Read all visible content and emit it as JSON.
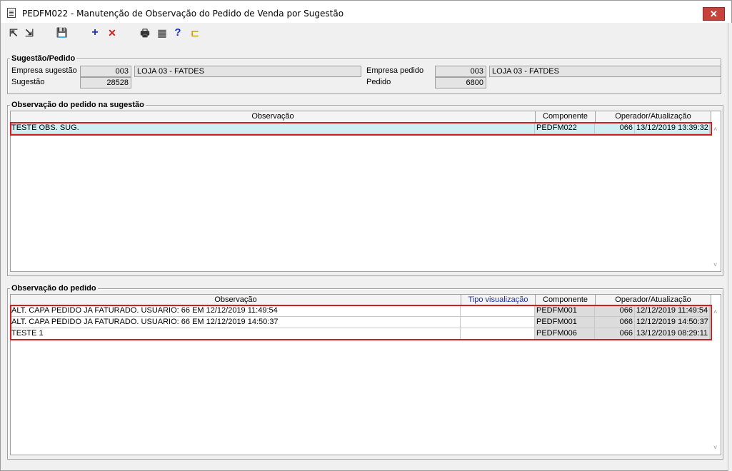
{
  "window": {
    "title": "PEDFM022 - Manutenção de Observação do Pedido de Venda por Sugestão",
    "close_glyph": "✕"
  },
  "toolbar": {
    "btn_first": "⇱",
    "btn_move": "⇲",
    "btn_save": "💾",
    "btn_add": "+",
    "btn_delete": "✕",
    "btn_print": "🖶",
    "btn_grid": "▦",
    "btn_help": "?",
    "btn_exit": "⊏"
  },
  "sugestao_pedido": {
    "label": "Sugestão/Pedido",
    "empresa_sugestao_label": "Empresa sugestão",
    "empresa_sugestao_code": "003",
    "empresa_sugestao_name": "LOJA 03 - FATDES",
    "sugestao_label": "Sugestão",
    "sugestao_value": "28528",
    "empresa_pedido_label": "Empresa pedido",
    "empresa_pedido_code": "003",
    "empresa_pedido_name": "LOJA 03 - FATDES",
    "pedido_label": "Pedido",
    "pedido_value": "6800"
  },
  "obs_sugestao": {
    "label": "Observação do pedido na sugestão",
    "headers": {
      "observacao": "Observação",
      "componente": "Componente",
      "operador": "Operador/Atualização"
    },
    "rows": [
      {
        "obs": "TESTE OBS. SUG.",
        "componente": "PEDFM022",
        "operador": "066",
        "data": "13/12/2019 13:39:32"
      }
    ]
  },
  "obs_pedido": {
    "label": "Observação do pedido",
    "headers": {
      "observacao": "Observação",
      "tipo": "Tipo visualização",
      "componente": "Componente",
      "operador": "Operador/Atualização"
    },
    "rows": [
      {
        "obs": "ALT. CAPA PEDIDO JA FATURADO. USUARIO: 66 EM 12/12/2019 11:49:54",
        "tipo": "",
        "componente": "PEDFM001",
        "operador": "066",
        "data": "12/12/2019 11:49:54"
      },
      {
        "obs": "ALT. CAPA PEDIDO JA FATURADO. USUARIO: 66 EM 12/12/2019 14:50:37",
        "tipo": "",
        "componente": "PEDFM001",
        "operador": "066",
        "data": "12/12/2019 14:50:37"
      },
      {
        "obs": "TESTE 1",
        "tipo": "",
        "componente": "PEDFM006",
        "operador": "066",
        "data": "13/12/2019 08:29:11"
      }
    ]
  },
  "colors": {
    "highlight": "#d41c1c",
    "selected_row": "#cfeff5",
    "close": "#c7423a"
  }
}
